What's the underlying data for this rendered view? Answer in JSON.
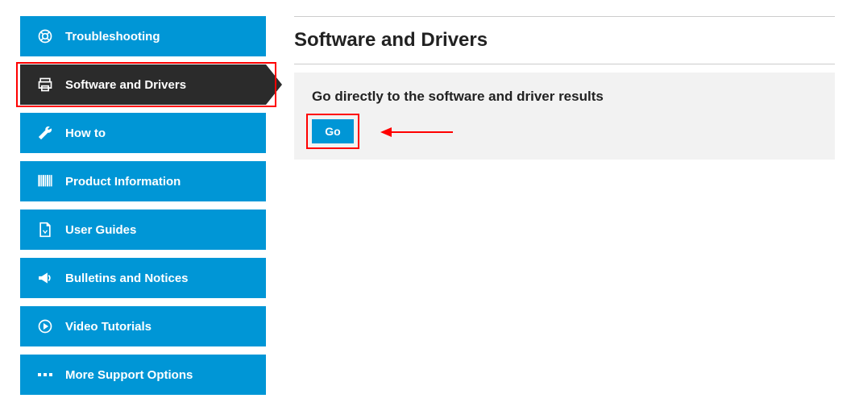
{
  "sidebar": {
    "items": [
      {
        "label": "Troubleshooting"
      },
      {
        "label": "Software and Drivers"
      },
      {
        "label": "How to"
      },
      {
        "label": "Product Information"
      },
      {
        "label": "User Guides"
      },
      {
        "label": "Bulletins and Notices"
      },
      {
        "label": "Video Tutorials"
      },
      {
        "label": "More Support Options"
      }
    ]
  },
  "main": {
    "title": "Software and Drivers",
    "panel_heading": "Go directly to the software and driver results",
    "go_label": "Go"
  },
  "colors": {
    "brand_blue": "#0096d6",
    "active_dark": "#2b2b2b",
    "highlight_red": "#ff0000",
    "panel_bg": "#f2f2f2"
  }
}
